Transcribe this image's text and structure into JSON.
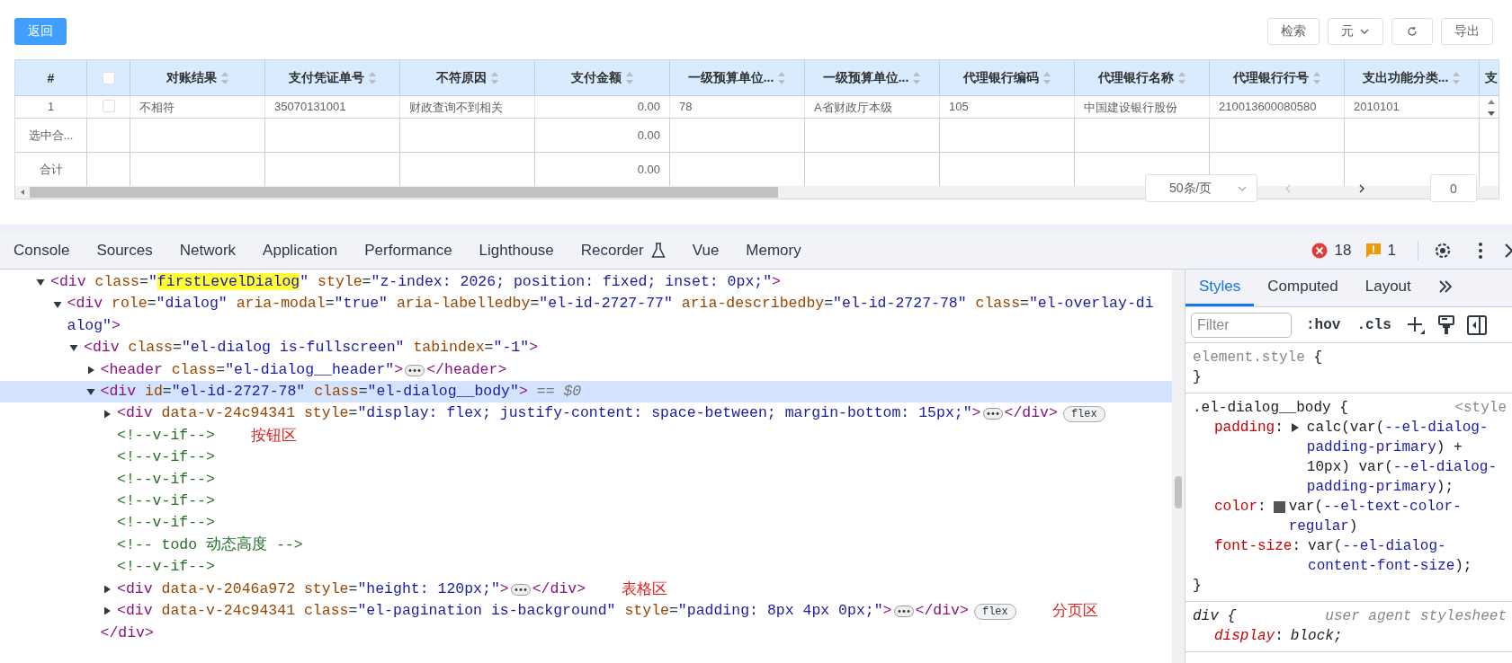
{
  "page": {
    "back_button": "返回",
    "toolbar": [
      {
        "kind": "text",
        "label": "检索"
      },
      {
        "kind": "dropdown",
        "label": "元"
      },
      {
        "kind": "refresh"
      },
      {
        "kind": "text",
        "label": "导出"
      }
    ],
    "table": {
      "columns": [
        {
          "kind": "index",
          "label": "#"
        },
        {
          "kind": "checkbox",
          "checked": false
        },
        {
          "kind": "text",
          "label": "对账结果",
          "sortable": true
        },
        {
          "kind": "text",
          "label": "支付凭证单号",
          "sortable": true
        },
        {
          "kind": "text",
          "label": "不符原因",
          "sortable": true
        },
        {
          "kind": "amount",
          "label": "支付金额",
          "sortable": true
        },
        {
          "kind": "text",
          "label": "一级预算单位...",
          "sortable": true
        },
        {
          "kind": "text",
          "label": "一级预算单位...",
          "sortable": true
        },
        {
          "kind": "text",
          "label": "代理银行编码",
          "sortable": true
        },
        {
          "kind": "text",
          "label": "代理银行名称",
          "sortable": true
        },
        {
          "kind": "text",
          "label": "代理银行行号",
          "sortable": true
        },
        {
          "kind": "text",
          "label": "支出功能分类...",
          "sortable": true
        },
        {
          "kind": "text",
          "label": "支",
          "sortable": false
        }
      ],
      "rows": [
        {
          "checked": false,
          "cells": [
            "1",
            null,
            "不相符",
            "35070131001",
            "财政查询不到相关",
            "0.00",
            "78",
            "A省财政厅本级",
            "105",
            "中国建设银行股份",
            "210013600080580",
            "2010101"
          ]
        }
      ],
      "footer": [
        {
          "label": "选中合...",
          "sum": "0.00"
        },
        {
          "label": "合计",
          "sum": "0.00"
        }
      ]
    },
    "pagination": {
      "page_size": "50条/页",
      "page": "0"
    }
  },
  "devtools": {
    "tabs": [
      {
        "label": "Console",
        "kind": "plain"
      },
      {
        "label": "Sources",
        "kind": "plain"
      },
      {
        "label": "Network",
        "kind": "plain"
      },
      {
        "label": "Application",
        "kind": "plain"
      },
      {
        "label": "Performance",
        "kind": "plain"
      },
      {
        "label": "Lighthouse",
        "kind": "plain"
      },
      {
        "label": "Recorder",
        "kind": "experimental"
      },
      {
        "label": "Vue",
        "kind": "plain"
      },
      {
        "label": "Memory",
        "kind": "plain"
      }
    ],
    "errors": "18",
    "warnings": "1",
    "elements": [
      {
        "expanded": true,
        "selected": false,
        "tokens": [
          {
            "kind": "tag",
            "text": "<div"
          },
          {
            "kind": "name",
            "text": " class"
          },
          {
            "kind": "eq",
            "text": "="
          },
          {
            "kind": "val",
            "text": "\""
          },
          {
            "kind": "hl",
            "text": "firstLevelDialog"
          },
          {
            "kind": "val",
            "text": "\""
          },
          {
            "kind": "name",
            "text": " style"
          },
          {
            "kind": "eq",
            "text": "="
          },
          {
            "kind": "val",
            "text": "\"z-index: 2026; position: fixed; inset: 0px;\""
          },
          {
            "kind": "tag",
            "text": ">"
          }
        ],
        "children": [
          {
            "expanded": true,
            "selected": false,
            "tokens": [
              {
                "kind": "tag",
                "text": "<div"
              },
              {
                "kind": "name",
                "text": " role"
              },
              {
                "kind": "eq",
                "text": "="
              },
              {
                "kind": "val",
                "text": "\"dialog\""
              },
              {
                "kind": "name",
                "text": " aria-modal"
              },
              {
                "kind": "eq",
                "text": "="
              },
              {
                "kind": "val",
                "text": "\"true\""
              },
              {
                "kind": "name",
                "text": " aria-labelledby"
              },
              {
                "kind": "eq",
                "text": "="
              },
              {
                "kind": "val",
                "text": "\"el-id-2727-77\""
              },
              {
                "kind": "name",
                "text": " aria-describedby"
              },
              {
                "kind": "eq",
                "text": "="
              },
              {
                "kind": "val",
                "text": "\"el-id-2727-78\""
              },
              {
                "kind": "name",
                "text": " class"
              },
              {
                "kind": "eq",
                "text": "="
              },
              {
                "kind": "val",
                "text": "\"el-overlay-dialog\""
              },
              {
                "kind": "tag",
                "text": ">"
              }
            ],
            "children": [
              {
                "expanded": true,
                "selected": false,
                "tokens": [
                  {
                    "kind": "tag",
                    "text": "<div"
                  },
                  {
                    "kind": "name",
                    "text": " class"
                  },
                  {
                    "kind": "eq",
                    "text": "="
                  },
                  {
                    "kind": "val",
                    "text": "\"el-dialog is-fullscreen\""
                  },
                  {
                    "kind": "name",
                    "text": " tabindex"
                  },
                  {
                    "kind": "eq",
                    "text": "="
                  },
                  {
                    "kind": "val",
                    "text": "\"-1\""
                  },
                  {
                    "kind": "tag",
                    "text": ">"
                  }
                ],
                "children": [
                  {
                    "expanded": false,
                    "selected": false,
                    "tokens": [
                      {
                        "kind": "tag",
                        "text": "<header"
                      },
                      {
                        "kind": "name",
                        "text": " class"
                      },
                      {
                        "kind": "eq",
                        "text": "="
                      },
                      {
                        "kind": "val",
                        "text": "\"el-dialog__header\""
                      },
                      {
                        "kind": "tag",
                        "text": ">"
                      },
                      {
                        "kind": "more"
                      },
                      {
                        "kind": "tag",
                        "text": "</header>"
                      }
                    ]
                  },
                  {
                    "expanded": true,
                    "selected": true,
                    "tokens": [
                      {
                        "kind": "tag",
                        "text": "<div"
                      },
                      {
                        "kind": "name",
                        "text": " id"
                      },
                      {
                        "kind": "eq",
                        "text": "="
                      },
                      {
                        "kind": "val",
                        "text": "\"el-id-2727-78\""
                      },
                      {
                        "kind": "name",
                        "text": " class"
                      },
                      {
                        "kind": "eq",
                        "text": "="
                      },
                      {
                        "kind": "val",
                        "text": "\"el-dialog__body\""
                      },
                      {
                        "kind": "tag",
                        "text": ">"
                      },
                      {
                        "kind": "dollar",
                        "text": " == $0"
                      }
                    ],
                    "closing": [
                      {
                        "kind": "tag",
                        "text": "</div>"
                      }
                    ],
                    "children": [
                      {
                        "expanded": false,
                        "selected": false,
                        "tokens": [
                          {
                            "kind": "tag",
                            "text": "<div"
                          },
                          {
                            "kind": "name",
                            "text": " data-v-24c94341"
                          },
                          {
                            "kind": "name",
                            "text": " style"
                          },
                          {
                            "kind": "eq",
                            "text": "="
                          },
                          {
                            "kind": "val",
                            "text": "\"display: flex; justify-content: space-between; margin-bottom: 15px;\""
                          },
                          {
                            "kind": "tag",
                            "text": ">"
                          },
                          {
                            "kind": "more"
                          },
                          {
                            "kind": "tag",
                            "text": "</div>"
                          },
                          {
                            "kind": "badge",
                            "text": "flex"
                          }
                        ]
                      },
                      {
                        "tokens": [
                          {
                            "kind": "comment",
                            "text": "<!--v-if-->"
                          },
                          {
                            "kind": "note",
                            "text": "按钮区"
                          }
                        ]
                      },
                      {
                        "tokens": [
                          {
                            "kind": "comment",
                            "text": "<!--v-if-->"
                          }
                        ]
                      },
                      {
                        "tokens": [
                          {
                            "kind": "comment",
                            "text": "<!--v-if-->"
                          }
                        ]
                      },
                      {
                        "tokens": [
                          {
                            "kind": "comment",
                            "text": "<!--v-if-->"
                          }
                        ]
                      },
                      {
                        "tokens": [
                          {
                            "kind": "comment",
                            "text": "<!--v-if-->"
                          }
                        ]
                      },
                      {
                        "tokens": [
                          {
                            "kind": "comment",
                            "text": "<!-- todo 动态高度 -->"
                          }
                        ]
                      },
                      {
                        "tokens": [
                          {
                            "kind": "comment",
                            "text": "<!--v-if-->"
                          }
                        ]
                      },
                      {
                        "expanded": false,
                        "selected": false,
                        "tokens": [
                          {
                            "kind": "tag",
                            "text": "<div"
                          },
                          {
                            "kind": "name",
                            "text": " data-v-2046a972"
                          },
                          {
                            "kind": "name",
                            "text": " style"
                          },
                          {
                            "kind": "eq",
                            "text": "="
                          },
                          {
                            "kind": "val",
                            "text": "\"height: 120px;\""
                          },
                          {
                            "kind": "tag",
                            "text": ">"
                          },
                          {
                            "kind": "more"
                          },
                          {
                            "kind": "tag",
                            "text": "</div>"
                          },
                          {
                            "kind": "note",
                            "text": "表格区"
                          }
                        ]
                      },
                      {
                        "expanded": false,
                        "selected": false,
                        "tokens": [
                          {
                            "kind": "tag",
                            "text": "<div"
                          },
                          {
                            "kind": "name",
                            "text": " data-v-24c94341"
                          },
                          {
                            "kind": "name",
                            "text": " class"
                          },
                          {
                            "kind": "eq",
                            "text": "="
                          },
                          {
                            "kind": "val",
                            "text": "\"el-pagination is-background\""
                          },
                          {
                            "kind": "name",
                            "text": " style"
                          },
                          {
                            "kind": "eq",
                            "text": "="
                          },
                          {
                            "kind": "val",
                            "text": "\"padding: 8px 4px 0px;\""
                          },
                          {
                            "kind": "tag",
                            "text": ">"
                          },
                          {
                            "kind": "more"
                          },
                          {
                            "kind": "tag",
                            "text": "</div>"
                          },
                          {
                            "kind": "badge",
                            "text": "flex"
                          },
                          {
                            "kind": "note",
                            "text": "分页区"
                          }
                        ]
                      }
                    ]
                  }
                ]
              }
            ]
          }
        ]
      }
    ],
    "styles": {
      "tabs": [
        {
          "label": "Styles",
          "selected": true
        },
        {
          "label": "Computed",
          "selected": false
        },
        {
          "label": "Layout",
          "selected": false
        }
      ],
      "filter_placeholder": "Filter",
      "toggles": [
        ":hov",
        ".cls"
      ],
      "rules": [
        {
          "selector": [
            {
              "kind": "muted",
              "text": "element.style"
            },
            {
              "kind": "plain",
              "text": " {"
            }
          ],
          "close": "}"
        },
        {
          "selector": [
            {
              "kind": "plain",
              "text": ".el-dialog__body {"
            }
          ],
          "kind": "author",
          "source": "<style",
          "close": "}",
          "declarations": [
            {
              "name": "padding",
              "colon": ":",
              "expandable": true,
              "value": [
                {
                  "kind": "plain",
                  "text": "calc(var("
                },
                {
                  "kind": "var",
                  "text": "--el-dialog-padding-primary"
                },
                {
                  "kind": "plain",
                  "text": ") + 10px) var("
                },
                {
                  "kind": "var",
                  "text": "--el-dialog-padding-primary"
                },
                {
                  "kind": "plain",
                  "text": ");"
                }
              ]
            },
            {
              "name": "color",
              "colon": ":",
              "expandable": false,
              "color": "#555555",
              "value": [
                {
                  "kind": "plain",
                  "text": "var("
                },
                {
                  "kind": "var",
                  "text": "--el-text-color-regular"
                },
                {
                  "kind": "plain",
                  "text": ")"
                }
              ]
            },
            {
              "name": "font-size",
              "colon": ":",
              "expandable": false,
              "value": [
                {
                  "kind": "plain",
                  "text": "var("
                },
                {
                  "kind": "var",
                  "text": "--el-dialog-content-font-size"
                },
                {
                  "kind": "plain",
                  "text": ");"
                }
              ]
            }
          ]
        },
        {
          "selector": [
            {
              "kind": "italic",
              "text": "div {"
            }
          ],
          "kind": "user-agent",
          "source": "user agent stylesheet",
          "declarations": [
            {
              "name": "display",
              "colon": ":",
              "expandable": false,
              "italic": true,
              "value": [
                {
                  "kind": "italic",
                  "text": "block;"
                }
              ]
            }
          ]
        }
      ]
    }
  }
}
